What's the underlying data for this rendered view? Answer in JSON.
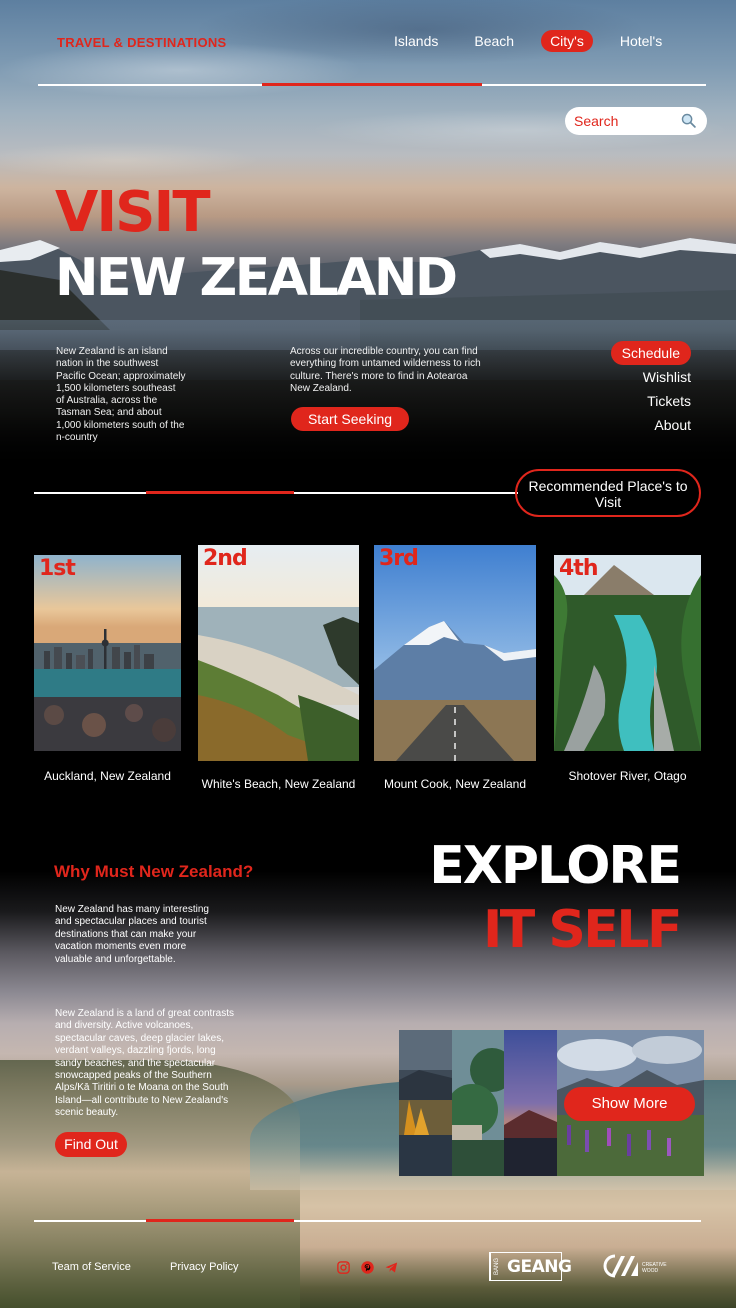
{
  "header": {
    "brand": "TRAVEL & DESTINATIONS",
    "nav": [
      {
        "label": "Islands",
        "active": false
      },
      {
        "label": "Beach",
        "active": false
      },
      {
        "label": "City's",
        "active": true
      },
      {
        "label": "Hotel's",
        "active": false
      }
    ],
    "search": {
      "placeholder": "Search",
      "icon": "search-icon"
    }
  },
  "hero": {
    "title_top": "VISIT",
    "title_bottom": "NEW ZEALAND",
    "para_left": "New Zealand is an island nation in the southwest Pacific Ocean; approximately 1,500 kilometers southeast of Australia, across the Tasman Sea; and about 1,000 kilometers south of the n-country",
    "para_center": "Across our incredible country, you can find everything from untamed wilderness to rich culture. There's more to find in Aotearoa New Zealand.",
    "cta": "Start Seeking",
    "side_menu": [
      {
        "label": "Schedule",
        "active": true
      },
      {
        "label": "Wishlist",
        "active": false
      },
      {
        "label": "Tickets",
        "active": false
      },
      {
        "label": "About",
        "active": false
      }
    ]
  },
  "recommended": {
    "label": "Recommended Place's to Visit",
    "cards": [
      {
        "rank": "1st",
        "caption": "Auckland, New Zealand"
      },
      {
        "rank": "2nd",
        "caption": "White's Beach, New Zealand"
      },
      {
        "rank": "3rd",
        "caption": "Mount Cook, New Zealand"
      },
      {
        "rank": "4th",
        "caption": "Shotover River, Otago"
      }
    ]
  },
  "explore": {
    "why_title": "Why Must New Zealand?",
    "para_1": "New Zealand has many interesting and spectacular places and tourist destinations that can make your vacation moments even more valuable and unforgettable.",
    "para_2": "New Zealand is a land of great contrasts and diversity. Active volcanoes, spectacular caves, deep glacier lakes, verdant valleys, dazzling fjords, long sandy beaches, and the spectacular snowcapped peaks of the Southern Alps/Kā Tiritiri o te Moana on the South Island—all contribute to New Zealand's scenic beauty.",
    "cta": "Find Out",
    "title_top": "EXPLORE",
    "title_bottom": "IT SELF",
    "show_more": "Show More"
  },
  "footer": {
    "terms": "Team of Service",
    "privacy": "Privacy Policy",
    "social_icons": [
      "instagram-icon",
      "pinterest-icon",
      "telegram-icon"
    ],
    "logo_bang_small": "BANG",
    "logo_bang_big": "GEANG",
    "logo_creative_text": "CREATIVE WOOD"
  },
  "colors": {
    "accent": "#e0261c",
    "text": "#ffffff",
    "background": "#000000"
  }
}
